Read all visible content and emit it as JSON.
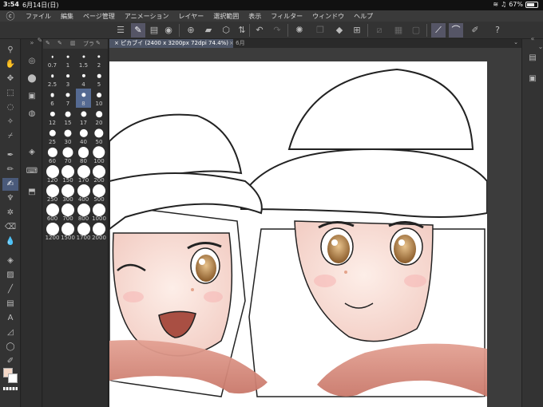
{
  "status": {
    "time": "3:54",
    "date": "6月14日(日)",
    "battery": "67%"
  },
  "menu": [
    "ファイル",
    "編集",
    "ページ管理",
    "アニメーション",
    "レイヤー",
    "選択範囲",
    "表示",
    "フィルター",
    "ウィンドウ",
    "ヘルプ"
  ],
  "document": {
    "tab_label": "ピカブイ (2400 x 3200px 72dpi 74.4%)",
    "tab2_label": "6月"
  },
  "brush_panel": {
    "tab_label": "ブラ"
  },
  "brush_sizes": [
    "0.7",
    "1",
    "1.5",
    "2",
    "2.5",
    "3",
    "4",
    "5",
    "6",
    "7",
    "8",
    "10",
    "12",
    "15",
    "17",
    "20",
    "25",
    "30",
    "40",
    "50",
    "60",
    "70",
    "80",
    "100",
    "120",
    "150",
    "170",
    "200",
    "250",
    "300",
    "400",
    "500",
    "600",
    "700",
    "800",
    "1000",
    "1200",
    "1500",
    "1700",
    "2000"
  ],
  "brush_selected": "8",
  "colors": {
    "main": "#f5d9c8",
    "sub": "#ffffff",
    "accent": "#556a92"
  }
}
